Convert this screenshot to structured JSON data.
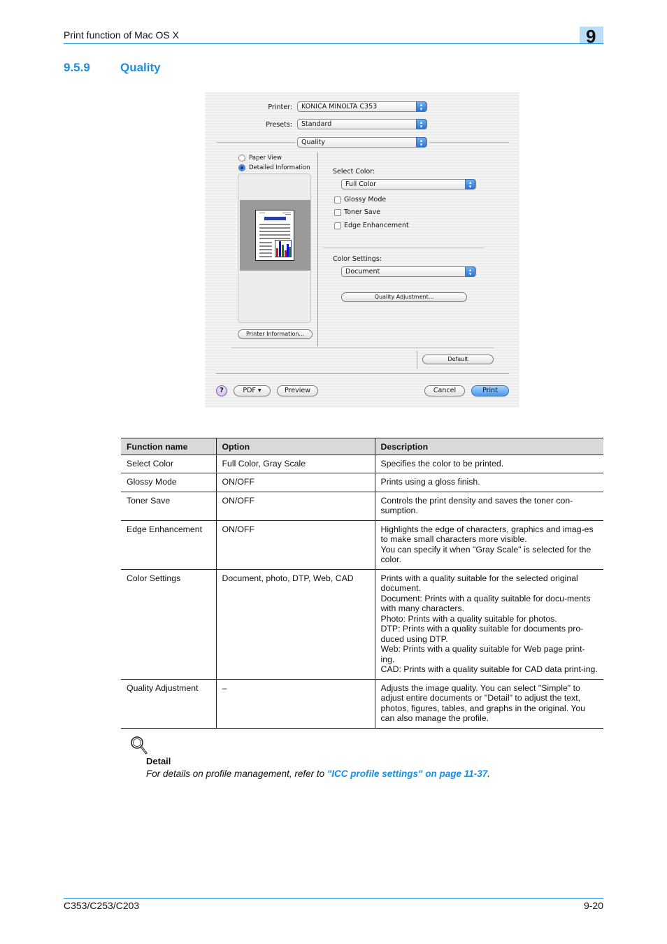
{
  "header": {
    "running_title": "Print function of Mac OS X",
    "chapter_number": "9"
  },
  "section": {
    "number": "9.5.9",
    "title": "Quality"
  },
  "dialog": {
    "printer_label": "Printer:",
    "printer_value": "KONICA MINOLTA C353",
    "presets_label": "Presets:",
    "presets_value": "Standard",
    "panel_value": "Quality",
    "view_options": [
      {
        "label": "Paper View",
        "selected": false
      },
      {
        "label": "Detailed Information",
        "selected": true
      }
    ],
    "printer_info_button": "Printer Information...",
    "select_color_label": "Select Color:",
    "select_color_value": "Full Color",
    "checkboxes": [
      {
        "label": "Glossy Mode",
        "checked": false
      },
      {
        "label": "Toner Save",
        "checked": false
      },
      {
        "label": "Edge Enhancement",
        "checked": false
      }
    ],
    "color_settings_label": "Color Settings:",
    "color_settings_value": "Document",
    "quality_adjustment_button": "Quality Adjustment...",
    "default_button": "Default",
    "help_button": "?",
    "pdf_button": "PDF ▾",
    "preview_button": "Preview",
    "cancel_button": "Cancel",
    "print_button": "Print",
    "colors": {
      "accent_blue": "#3a7fd8",
      "help_purple": "#c9b3f2"
    }
  },
  "table": {
    "headers": [
      "Function name",
      "Option",
      "Description"
    ],
    "rows": [
      {
        "function": "Select Color",
        "option": "Full Color, Gray Scale",
        "description": [
          "Specifies the color to be printed."
        ]
      },
      {
        "function": "Glossy Mode",
        "option": "ON/OFF",
        "description": [
          "Prints using a gloss finish."
        ]
      },
      {
        "function": "Toner Save",
        "option": "ON/OFF",
        "description": [
          "Controls the print density and saves the toner con-sumption."
        ]
      },
      {
        "function": "Edge Enhancement",
        "option": "ON/OFF",
        "description": [
          "Highlights the edge of characters, graphics and imag-es to make small characters more visible.",
          "You can specify it when \"Gray Scale\" is selected for the color."
        ]
      },
      {
        "function": "Color Settings",
        "option": "Document, photo, DTP, Web, CAD",
        "description": [
          "Prints with a quality suitable for the selected original document.",
          "Document: Prints with a quality suitable for docu-ments with many characters.",
          "Photo: Prints with a quality suitable for photos.",
          "DTP: Prints with a quality suitable for documents pro-duced using DTP.",
          "Web: Prints with a quality suitable for Web page print-ing.",
          "CAD: Prints with a quality suitable for CAD data print-ing."
        ]
      },
      {
        "function": "Quality Adjustment",
        "option": "–",
        "description": [
          "Adjusts the image quality. You can select \"Simple\" to adjust entire documents or \"Detail\" to adjust the text, photos, figures, tables, and graphs in the original. You can also manage the profile."
        ]
      }
    ]
  },
  "detail": {
    "icon": "magnifier-icon",
    "heading": "Detail",
    "text_before": "For details on profile management, refer to ",
    "link_text": "\"ICC profile settings\" on page 11-37",
    "text_after": "."
  },
  "footer": {
    "model": "C353/C253/C203",
    "page": "9-20"
  }
}
